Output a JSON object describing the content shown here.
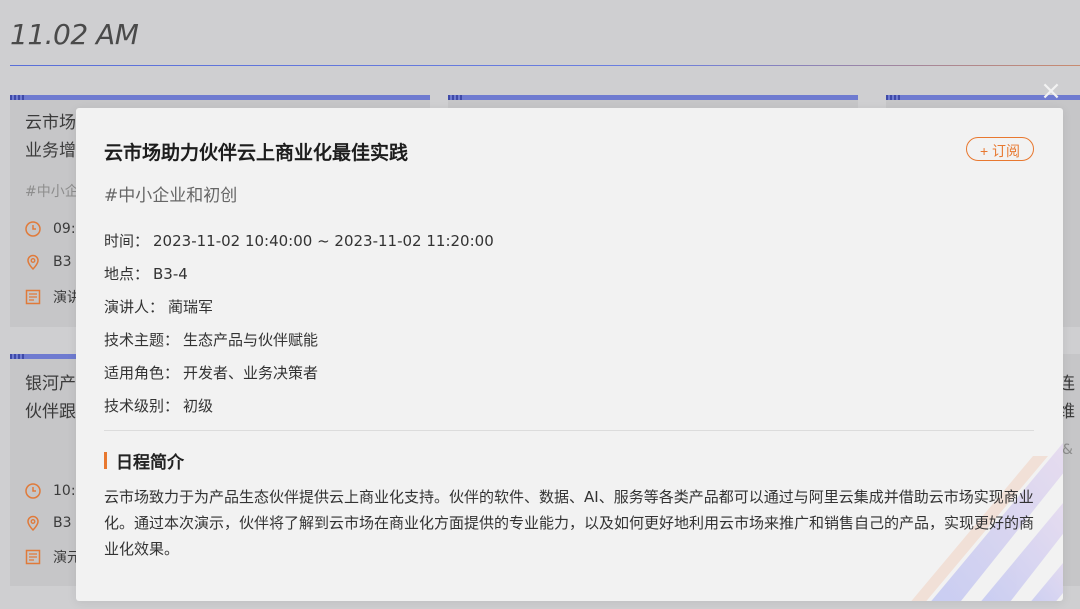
{
  "page": {
    "time_heading": "11.02 AM"
  },
  "background_cards": [
    {
      "title_lines": [
        "云市场",
        "业务增"
      ],
      "tag": "#中小企",
      "rows": [
        {
          "icon": "clock-icon",
          "text": "09:"
        },
        {
          "icon": "location-icon",
          "text": "B3"
        },
        {
          "icon": "document-icon",
          "text": "演讲"
        }
      ]
    },
    {
      "title_lines": [
        "银河产",
        "伙伴跟"
      ],
      "rows": [
        {
          "icon": "clock-icon",
          "text": "10:"
        },
        {
          "icon": "location-icon",
          "text": "B3"
        },
        {
          "icon": "document-icon",
          "text": "演元"
        }
      ]
    },
    {
      "title_lines": [
        "连维"
      ],
      "tag": "&"
    }
  ],
  "modal": {
    "title": "云市场助力伙伴云上商业化最佳实践",
    "subscribe_label": "+ 订阅",
    "tag": "#中小企业和初创",
    "details": [
      {
        "label": "时间：",
        "value": "2023-11-02 10:40:00 ~ 2023-11-02 11:20:00"
      },
      {
        "label": "地点：",
        "value": "B3-4"
      },
      {
        "label": "演讲人：",
        "value": "蔺瑞军"
      },
      {
        "label": "技术主题：",
        "value": "生态产品与伙伴赋能"
      },
      {
        "label": "适用角色：",
        "value": "开发者、业务决策者"
      },
      {
        "label": "技术级别：",
        "value": "初级"
      }
    ],
    "section_title": "日程简介",
    "description": "云市场致力于为产品生态伙伴提供云上商业化支持。伙伴的软件、数据、AI、服务等各类产品都可以通过与阿里云集成并借助云市场实现商业化。通过本次演示，伙伴将了解到云市场在商业化方面提供的专业能力，以及如何更好地利用云市场来推广和销售自己的产品，实现更好的商业化效果。"
  },
  "colors": {
    "accent": "#e8782f",
    "topbar": "#6f7bd0",
    "overlay": "#cfcfd1"
  }
}
